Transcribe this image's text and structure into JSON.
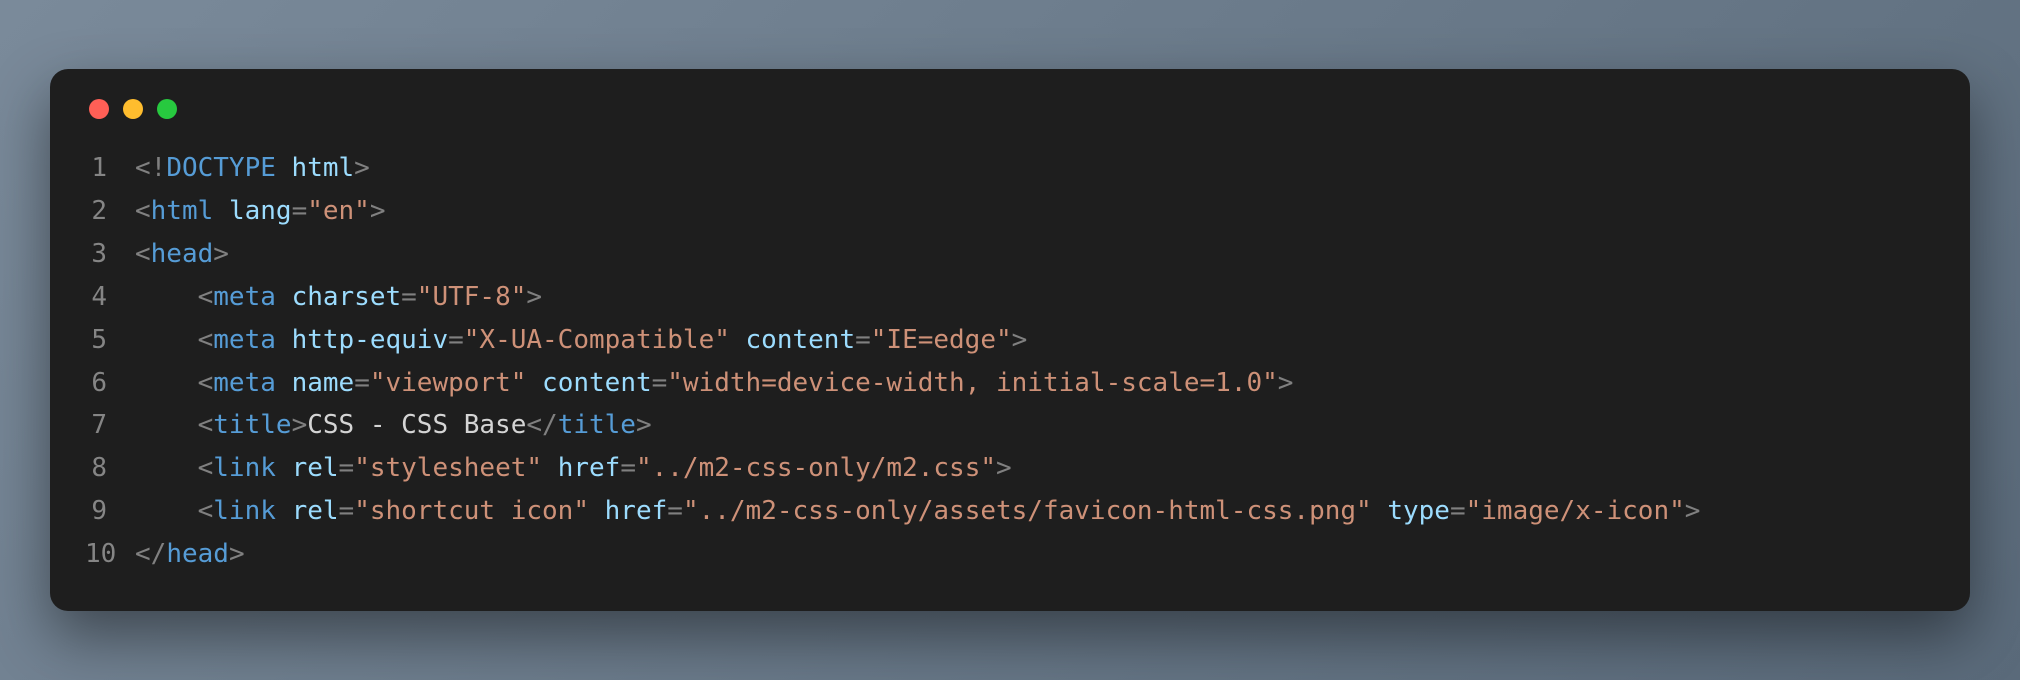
{
  "window": {
    "buttons": [
      "close",
      "minimize",
      "zoom"
    ]
  },
  "code": {
    "lines": [
      {
        "num": "1",
        "indent": "",
        "tokens": [
          {
            "t": "pun",
            "v": "<!"
          },
          {
            "t": "doctype",
            "v": "DOCTYPE"
          },
          {
            "t": "txt",
            "v": " "
          },
          {
            "t": "attr",
            "v": "html"
          },
          {
            "t": "pun",
            "v": ">"
          }
        ]
      },
      {
        "num": "2",
        "indent": "",
        "tokens": [
          {
            "t": "pun",
            "v": "<"
          },
          {
            "t": "tag",
            "v": "html"
          },
          {
            "t": "txt",
            "v": " "
          },
          {
            "t": "attr",
            "v": "lang"
          },
          {
            "t": "pun",
            "v": "="
          },
          {
            "t": "str",
            "v": "\"en\""
          },
          {
            "t": "pun",
            "v": ">"
          }
        ]
      },
      {
        "num": "3",
        "indent": "",
        "tokens": [
          {
            "t": "pun",
            "v": "<"
          },
          {
            "t": "tag",
            "v": "head"
          },
          {
            "t": "pun",
            "v": ">"
          }
        ]
      },
      {
        "num": "4",
        "indent": "    ",
        "tokens": [
          {
            "t": "pun",
            "v": "<"
          },
          {
            "t": "tag",
            "v": "meta"
          },
          {
            "t": "txt",
            "v": " "
          },
          {
            "t": "attr",
            "v": "charset"
          },
          {
            "t": "pun",
            "v": "="
          },
          {
            "t": "str",
            "v": "\"UTF-8\""
          },
          {
            "t": "pun",
            "v": ">"
          }
        ]
      },
      {
        "num": "5",
        "indent": "    ",
        "tokens": [
          {
            "t": "pun",
            "v": "<"
          },
          {
            "t": "tag",
            "v": "meta"
          },
          {
            "t": "txt",
            "v": " "
          },
          {
            "t": "attr",
            "v": "http-equiv"
          },
          {
            "t": "pun",
            "v": "="
          },
          {
            "t": "str",
            "v": "\"X-UA-Compatible\""
          },
          {
            "t": "txt",
            "v": " "
          },
          {
            "t": "attr",
            "v": "content"
          },
          {
            "t": "pun",
            "v": "="
          },
          {
            "t": "str",
            "v": "\"IE=edge\""
          },
          {
            "t": "pun",
            "v": ">"
          }
        ]
      },
      {
        "num": "6",
        "indent": "    ",
        "tokens": [
          {
            "t": "pun",
            "v": "<"
          },
          {
            "t": "tag",
            "v": "meta"
          },
          {
            "t": "txt",
            "v": " "
          },
          {
            "t": "attr",
            "v": "name"
          },
          {
            "t": "pun",
            "v": "="
          },
          {
            "t": "str",
            "v": "\"viewport\""
          },
          {
            "t": "txt",
            "v": " "
          },
          {
            "t": "attr",
            "v": "content"
          },
          {
            "t": "pun",
            "v": "="
          },
          {
            "t": "str",
            "v": "\"width=device-width, initial-scale=1.0\""
          },
          {
            "t": "pun",
            "v": ">"
          }
        ]
      },
      {
        "num": "7",
        "indent": "    ",
        "tokens": [
          {
            "t": "pun",
            "v": "<"
          },
          {
            "t": "tag",
            "v": "title"
          },
          {
            "t": "pun",
            "v": ">"
          },
          {
            "t": "txt",
            "v": "CSS - CSS Base"
          },
          {
            "t": "pun",
            "v": "</"
          },
          {
            "t": "tag",
            "v": "title"
          },
          {
            "t": "pun",
            "v": ">"
          }
        ]
      },
      {
        "num": "8",
        "indent": "    ",
        "tokens": [
          {
            "t": "pun",
            "v": "<"
          },
          {
            "t": "tag",
            "v": "link"
          },
          {
            "t": "txt",
            "v": " "
          },
          {
            "t": "attr",
            "v": "rel"
          },
          {
            "t": "pun",
            "v": "="
          },
          {
            "t": "str",
            "v": "\"stylesheet\""
          },
          {
            "t": "txt",
            "v": " "
          },
          {
            "t": "attr",
            "v": "href"
          },
          {
            "t": "pun",
            "v": "="
          },
          {
            "t": "str",
            "v": "\"../m2-css-only/m2.css\""
          },
          {
            "t": "pun",
            "v": ">"
          }
        ]
      },
      {
        "num": "9",
        "indent": "    ",
        "tokens": [
          {
            "t": "pun",
            "v": "<"
          },
          {
            "t": "tag",
            "v": "link"
          },
          {
            "t": "txt",
            "v": " "
          },
          {
            "t": "attr",
            "v": "rel"
          },
          {
            "t": "pun",
            "v": "="
          },
          {
            "t": "str",
            "v": "\"shortcut icon\""
          },
          {
            "t": "txt",
            "v": " "
          },
          {
            "t": "attr",
            "v": "href"
          },
          {
            "t": "pun",
            "v": "="
          },
          {
            "t": "str",
            "v": "\"../m2-css-only/assets/favicon-html-css.png\""
          },
          {
            "t": "txt",
            "v": " "
          },
          {
            "t": "attr",
            "v": "type"
          },
          {
            "t": "pun",
            "v": "="
          },
          {
            "t": "str",
            "v": "\"image/x-icon\""
          },
          {
            "t": "pun",
            "v": ">"
          }
        ]
      },
      {
        "num": "10",
        "indent": "",
        "tokens": [
          {
            "t": "pun",
            "v": "</"
          },
          {
            "t": "tag",
            "v": "head"
          },
          {
            "t": "pun",
            "v": ">"
          }
        ]
      }
    ]
  }
}
